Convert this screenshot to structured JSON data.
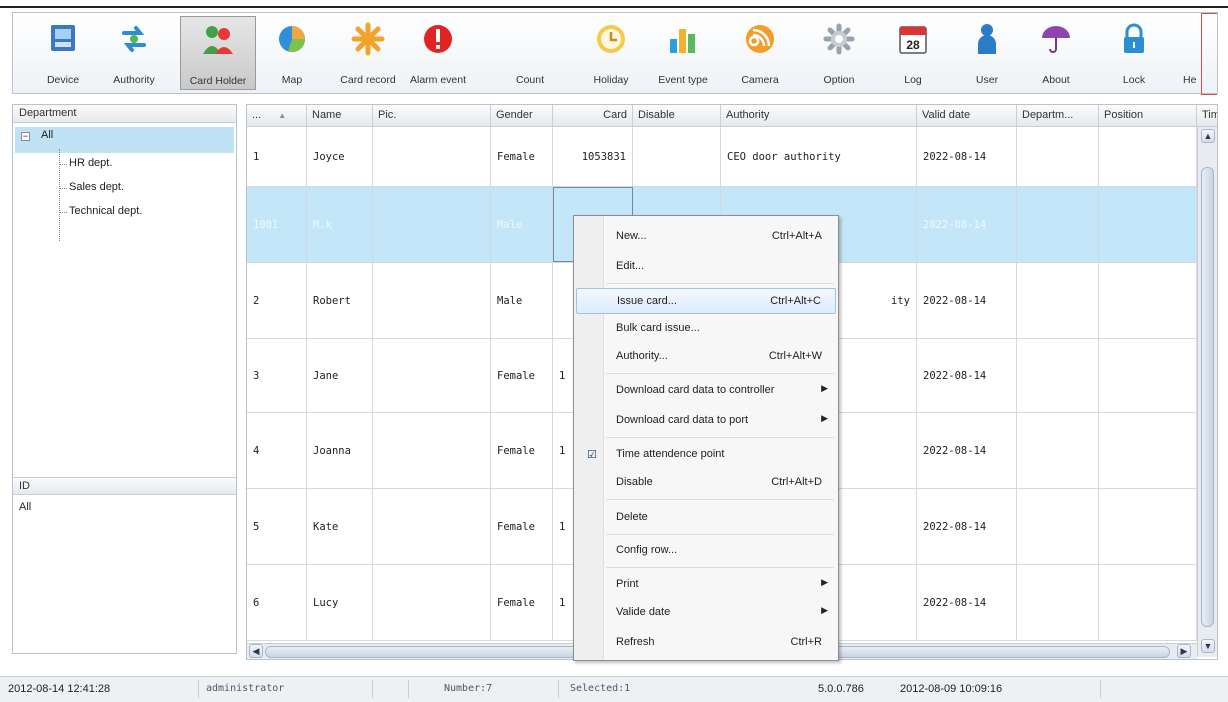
{
  "toolbar": {
    "buttons": [
      {
        "label": "Device",
        "icon": "device-icon"
      },
      {
        "label": "Authority",
        "icon": "authority-icon"
      },
      {
        "label": "Card Holder",
        "icon": "card-holder-icon",
        "active": true
      },
      {
        "label": "Map",
        "icon": "map-icon"
      },
      {
        "label": "Card record",
        "icon": "card-record-icon"
      },
      {
        "label": "Alarm event",
        "icon": "alarm-event-icon"
      },
      {
        "label": "Count",
        "icon": "count-icon"
      },
      {
        "label": "Holiday",
        "icon": "holiday-icon"
      },
      {
        "label": "Event type",
        "icon": "event-type-icon"
      },
      {
        "label": "Camera",
        "icon": "camera-icon"
      },
      {
        "label": "Option",
        "icon": "option-icon"
      },
      {
        "label": "Log",
        "icon": "log-icon"
      },
      {
        "label": "User",
        "icon": "user-icon"
      },
      {
        "label": "About",
        "icon": "about-icon"
      },
      {
        "label": "Lock",
        "icon": "lock-icon"
      },
      {
        "label": "He"
      }
    ],
    "log_day": "28"
  },
  "left_panel": {
    "department_header": "Department",
    "root": "All",
    "departments": [
      "HR dept.",
      "Sales dept.",
      "Technical dept."
    ],
    "id_header": "ID",
    "id_value": "All"
  },
  "grid": {
    "columns": [
      "...",
      "Name",
      "Pic.",
      "Gender",
      "Card",
      "Disable",
      "Authority",
      "Valid date",
      "Departm...",
      "Position",
      "Tim"
    ],
    "sort_indicator": "▲",
    "rows": [
      {
        "no": "1",
        "name": "Joyce",
        "gender": "Female",
        "card": "1053831",
        "authority": "CEO door authority",
        "valid": "2022-08-14"
      },
      {
        "no": "1001",
        "name": "M.k",
        "gender": "Male",
        "card": "",
        "authority": "",
        "valid": "2022-08-14",
        "selected": true
      },
      {
        "no": "2",
        "name": "Robert",
        "gender": "Male",
        "card": "",
        "authority": "ity",
        "valid": "2022-08-14"
      },
      {
        "no": "3",
        "name": "Jane",
        "gender": "Female",
        "card": "1",
        "authority": "",
        "valid": "2022-08-14"
      },
      {
        "no": "4",
        "name": "Joanna",
        "gender": "Female",
        "card": "1",
        "authority": "",
        "valid": "2022-08-14"
      },
      {
        "no": "5",
        "name": "Kate",
        "gender": "Female",
        "card": "1",
        "authority": "",
        "valid": "2022-08-14"
      },
      {
        "no": "6",
        "name": "Lucy",
        "gender": "Female",
        "card": "1",
        "authority": "",
        "valid": "2022-08-14"
      }
    ]
  },
  "context_menu": {
    "items": [
      {
        "label": "New...",
        "shortcut": "Ctrl+Alt+A"
      },
      {
        "label": "Edit..."
      },
      {
        "label": "Issue card...",
        "shortcut": "Ctrl+Alt+C"
      },
      {
        "label": "Bulk card issue..."
      },
      {
        "label": "Authority...",
        "shortcut": "Ctrl+Alt+W"
      },
      {
        "label": "Download card data to controller",
        "submenu": "▶"
      },
      {
        "label": "Download card data to port",
        "submenu": "▶"
      },
      {
        "label": "Time attendence point",
        "checked": "☑"
      },
      {
        "label": "Disable",
        "shortcut": "Ctrl+Alt+D"
      },
      {
        "label": "Delete"
      },
      {
        "label": "Config row..."
      },
      {
        "label": "Print",
        "submenu": "▶"
      },
      {
        "label": "Valide date",
        "submenu": "▶"
      },
      {
        "label": "Refresh",
        "shortcut": "Ctrl+R"
      }
    ]
  },
  "status_bar": {
    "datetime": "2012-08-14 12:41:28",
    "user": "administrator",
    "number": "Number:7",
    "selected": "Selected:1",
    "version": "5.0.0.786",
    "build_date": "2012-08-09 10:09:16"
  },
  "colors": {
    "selection": "#c3e7f8",
    "menu_highlight": "#dcebfb",
    "toolbar_border": "#b9c3cf"
  }
}
